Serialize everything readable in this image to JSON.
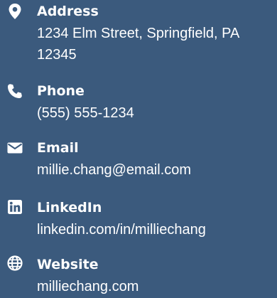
{
  "contact": {
    "items": [
      {
        "icon": "map-pin-icon",
        "label": "Address",
        "value": "1234 Elm Street, Springfield, PA 12345"
      },
      {
        "icon": "phone-icon",
        "label": "Phone",
        "value": "(555) 555-1234"
      },
      {
        "icon": "envelope-icon",
        "label": "Email",
        "value": "millie.chang@email.com"
      },
      {
        "icon": "linkedin-icon",
        "label": "LinkedIn",
        "value": "linkedin.com/in/milliechang"
      },
      {
        "icon": "globe-icon",
        "label": "Website",
        "value": "milliechang.com"
      }
    ]
  },
  "colors": {
    "background": "#3b5a7d",
    "text": "#ffffff"
  }
}
